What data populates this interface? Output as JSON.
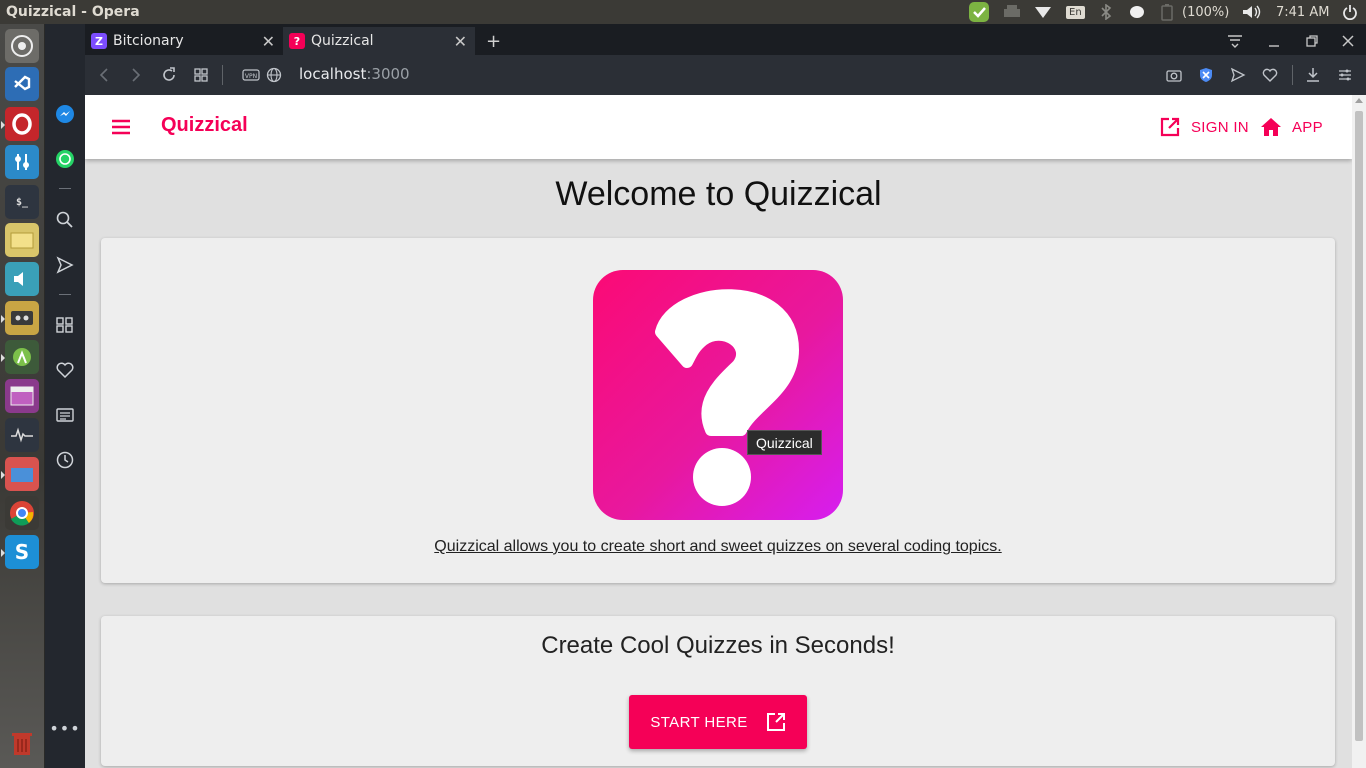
{
  "system": {
    "window_title": "Quizzical - Opera",
    "keyboard": "En",
    "battery": "(100%)",
    "clock": "7:41 AM"
  },
  "browser": {
    "tabs": [
      {
        "label": "Bitcionary",
        "favicon": "Z",
        "favicon_color": "#7c4dff"
      },
      {
        "label": "Quizzical",
        "favicon": "?",
        "favicon_color": "#f50057"
      }
    ],
    "url_host": "localhost",
    "url_port": ":3000"
  },
  "app": {
    "brand": "Quizzical",
    "nav": {
      "sign_in": "SIGN IN",
      "app": "APP"
    },
    "heading": "Welcome to Quizzical",
    "logo_tooltip": "Quizzical",
    "tagline": "Quizzical allows you to create short and sweet quizzes on several coding topics.",
    "card2_title": "Create Cool Quizzes in Seconds!",
    "start_button": "START HERE",
    "accent_color": "#f50057"
  }
}
